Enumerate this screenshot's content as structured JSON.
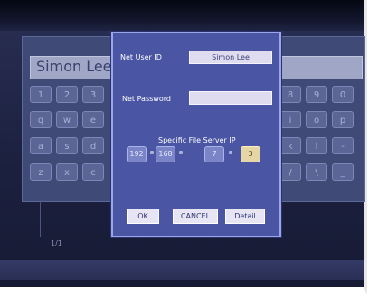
{
  "background": {
    "keyboard_input_value": "Simon Lee",
    "page_count": "1/1",
    "keys": [
      {
        "label": "1",
        "row": 0,
        "col": 0
      },
      {
        "label": "2",
        "row": 0,
        "col": 1
      },
      {
        "label": "3",
        "row": 0,
        "col": 2
      },
      {
        "label": "8",
        "row": 0,
        "col": 9
      },
      {
        "label": "9",
        "row": 0,
        "col": 10
      },
      {
        "label": "0",
        "row": 0,
        "col": 11
      },
      {
        "label": "q",
        "row": 1,
        "col": 0
      },
      {
        "label": "w",
        "row": 1,
        "col": 1
      },
      {
        "label": "e",
        "row": 1,
        "col": 2
      },
      {
        "label": "i",
        "row": 1,
        "col": 9
      },
      {
        "label": "o",
        "row": 1,
        "col": 10
      },
      {
        "label": "p",
        "row": 1,
        "col": 11
      },
      {
        "label": "a",
        "row": 2,
        "col": 0
      },
      {
        "label": "s",
        "row": 2,
        "col": 1
      },
      {
        "label": "d",
        "row": 2,
        "col": 2
      },
      {
        "label": "k",
        "row": 2,
        "col": 9
      },
      {
        "label": "l",
        "row": 2,
        "col": 10
      },
      {
        "label": "-",
        "row": 2,
        "col": 11
      },
      {
        "label": "z",
        "row": 3,
        "col": 0
      },
      {
        "label": "x",
        "row": 3,
        "col": 1
      },
      {
        "label": "c",
        "row": 3,
        "col": 2
      },
      {
        "label": "/",
        "row": 3,
        "col": 9
      },
      {
        "label": "\\",
        "row": 3,
        "col": 10
      },
      {
        "label": "_",
        "row": 3,
        "col": 11
      }
    ]
  },
  "dialog": {
    "user_id_label": "Net User ID",
    "user_id_value": "Simon Lee",
    "password_label": "Net Password",
    "password_value": "",
    "server_ip_label": "Specific File Server IP",
    "ip": [
      "192",
      "168",
      "7",
      "3"
    ],
    "buttons": {
      "ok": "OK",
      "cancel": "CANCEL",
      "detail": "Detail"
    }
  },
  "colors": {
    "dialog_bg": "#4a55a3",
    "dialog_border": "#9aa6e8",
    "field_bg": "#dedcee",
    "active_ip": "#e6d6a6"
  }
}
